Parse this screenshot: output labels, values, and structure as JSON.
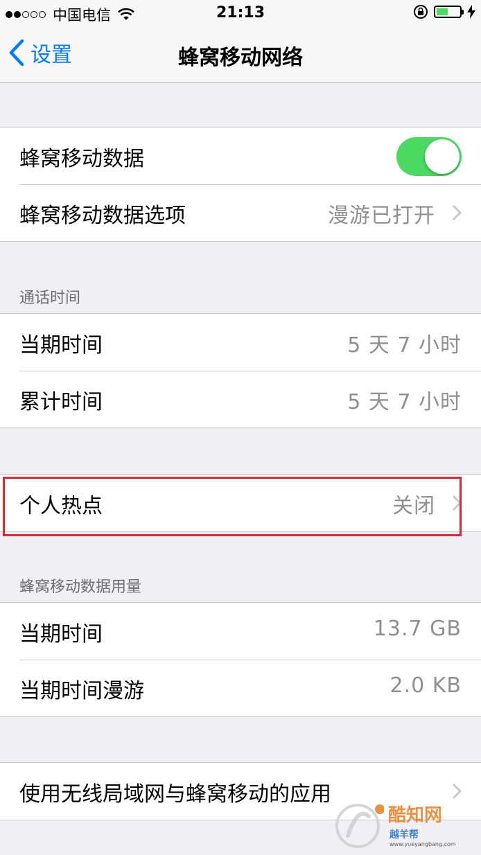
{
  "status_bar": {
    "signal_dots": [
      true,
      true,
      false,
      false,
      false
    ],
    "carrier": "中国电信",
    "time": "21:13",
    "battery_level": 0.5
  },
  "nav": {
    "back_label": "设置",
    "title": "蜂窝移动网络"
  },
  "cellular_group": {
    "data_label": "蜂窝移动数据",
    "data_enabled": true,
    "options_label": "蜂窝移动数据选项",
    "options_value": "漫游已打开"
  },
  "call_time": {
    "header": "通话时间",
    "current_label": "当期时间",
    "current_value": "5 天 7 小时",
    "total_label": "累计时间",
    "total_value": "5 天 7 小时"
  },
  "hotspot": {
    "label": "个人热点",
    "value": "关闭"
  },
  "data_usage": {
    "header": "蜂窝移动数据用量",
    "current_label": "当期时间",
    "current_value": "13.7 GB",
    "roaming_label": "当期时间漫游",
    "roaming_value": "2.0 KB"
  },
  "apps": {
    "label": "使用无线局域网与蜂窝移动的应用"
  },
  "watermark": {
    "line1": "酷知网",
    "line2": "越羊帮",
    "line3": "www.yueyangbang.com"
  },
  "colors": {
    "accent": "#007aff",
    "toggle_on": "#4cd964",
    "highlight": "#e0262e",
    "secondary_text": "#8e8e93"
  }
}
